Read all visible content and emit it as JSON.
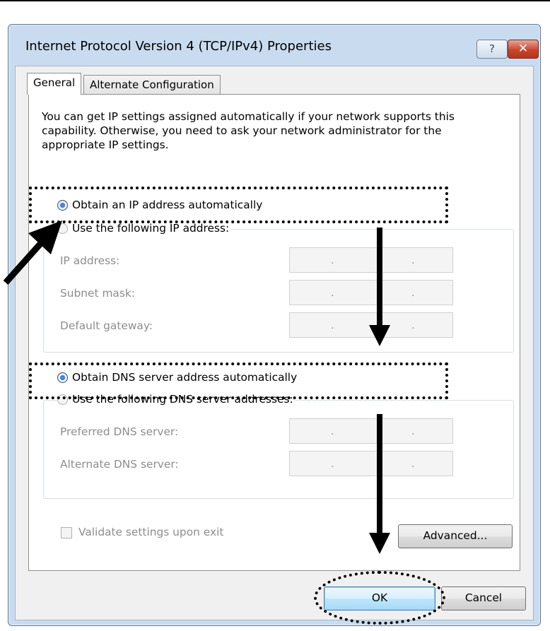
{
  "window": {
    "title": "Internet Protocol Version 4 (TCP/IPv4) Properties",
    "help_glyph": "?",
    "close_glyph": "✕"
  },
  "tabs": [
    {
      "label": "General",
      "active": true
    },
    {
      "label": "Alternate Configuration",
      "active": false
    }
  ],
  "intro_text": "You can get IP settings assigned automatically if your network supports this capability. Otherwise, you need to ask your network administrator for the appropriate IP settings.",
  "ip_section": {
    "auto_label": "Obtain an IP address automatically",
    "auto_selected": true,
    "manual_label": "Use the following IP address:",
    "fields": [
      {
        "label": "IP address:",
        "value": ""
      },
      {
        "label": "Subnet mask:",
        "value": ""
      },
      {
        "label": "Default gateway:",
        "value": ""
      }
    ]
  },
  "dns_section": {
    "auto_label": "Obtain DNS server address automatically",
    "auto_selected": true,
    "manual_label": "Use the following DNS server addresses:",
    "fields": [
      {
        "label": "Preferred DNS server:",
        "value": ""
      },
      {
        "label": "Alternate DNS server:",
        "value": ""
      }
    ]
  },
  "validate_label": "Validate settings upon exit",
  "validate_checked": false,
  "buttons": {
    "advanced": "Advanced...",
    "ok": "OK",
    "cancel": "Cancel"
  },
  "ip_separator": ".",
  "colors": {
    "title_bg": "#c9dcef",
    "close_red": "#c8452c",
    "disabled_text": "#8d8d8d"
  }
}
